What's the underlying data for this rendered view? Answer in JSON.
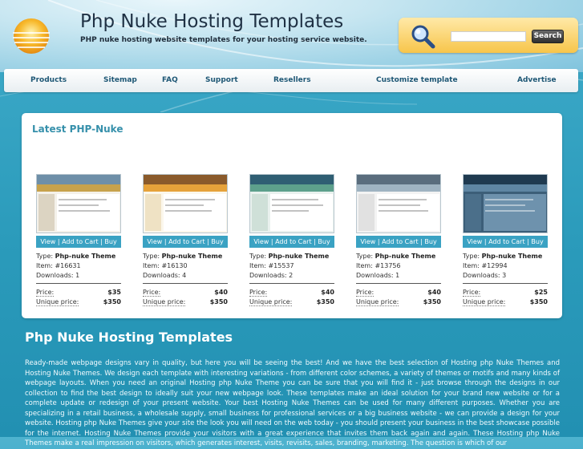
{
  "header": {
    "site_title": "Php Nuke Hosting Templates",
    "tagline": "PHP nuke hosting website templates for your hosting service website."
  },
  "search": {
    "button_label": "Search",
    "value": ""
  },
  "nav": {
    "items": [
      {
        "label": "Products"
      },
      {
        "label": "Sitemap"
      },
      {
        "label": "FAQ"
      },
      {
        "label": "Support"
      },
      {
        "label": "Resellers"
      },
      {
        "label": "Customize template"
      },
      {
        "label": "Advertise"
      }
    ]
  },
  "latest": {
    "title": "Latest PHP-Nuke",
    "view_label": "View | Add to Cart | Buy",
    "type_prefix": "Type:",
    "price_label": "Price:",
    "unique_label": "Unique price:",
    "products": [
      {
        "type": "Php-nuke Theme",
        "item": "Item: #16631",
        "downloads": "Downloads: 1",
        "price": "$35",
        "unique": "$350"
      },
      {
        "type": "Php-nuke Theme",
        "item": "Item: #16130",
        "downloads": "Downloads: 4",
        "price": "$40",
        "unique": "$350"
      },
      {
        "type": "Php-nuke Theme",
        "item": "Item: #15537",
        "downloads": "Downloads: 2",
        "price": "$40",
        "unique": "$350"
      },
      {
        "type": "Php-nuke Theme",
        "item": "Item: #13756",
        "downloads": "Downloads: 1",
        "price": "$40",
        "unique": "$350"
      },
      {
        "type": "Php-nuke Theme",
        "item": "Item: #12994",
        "downloads": "Downloads: 3",
        "price": "$25",
        "unique": "$350"
      }
    ]
  },
  "content": {
    "title": "Php Nuke Hosting Templates",
    "body": "Ready-made webpage designs vary in quality, but here you will be seeing the best! And we have the best selection of Hosting php Nuke Themes and Hosting Nuke Themes. We design each template with interesting variations - from different color schemes, a variety of themes or motifs and many kinds of webpage layouts. When you need an original Hosting php Nuke Theme you can be sure that you will find it - just browse through the designs in our collection to find the best design to ideally suit your new webpage look. These templates make an ideal solution for your brand new website or for a complete update or redesign of your present website. Your best Hosting Nuke Themes can be used for many different purposes. Whether you are specializing in a retail business, a wholesale supply, small business for professional services or a big business website - we can provide a design for your website. Hosting php Nuke Themes give your site the look you will need on the web today - you should present your business in the best showcase possible for the internet. Hosting Nuke Themes provide your visitors with a great experience that invites them back again and again. These Hosting php Nuke Themes make a real impression on visitors, which generates interest, visits, revisits, sales, branding, marketing. The question is which of our"
  },
  "colors": {
    "accent": "#3aa2c3",
    "title_blue": "#3690ab",
    "search_bg": "#f7c54a"
  }
}
